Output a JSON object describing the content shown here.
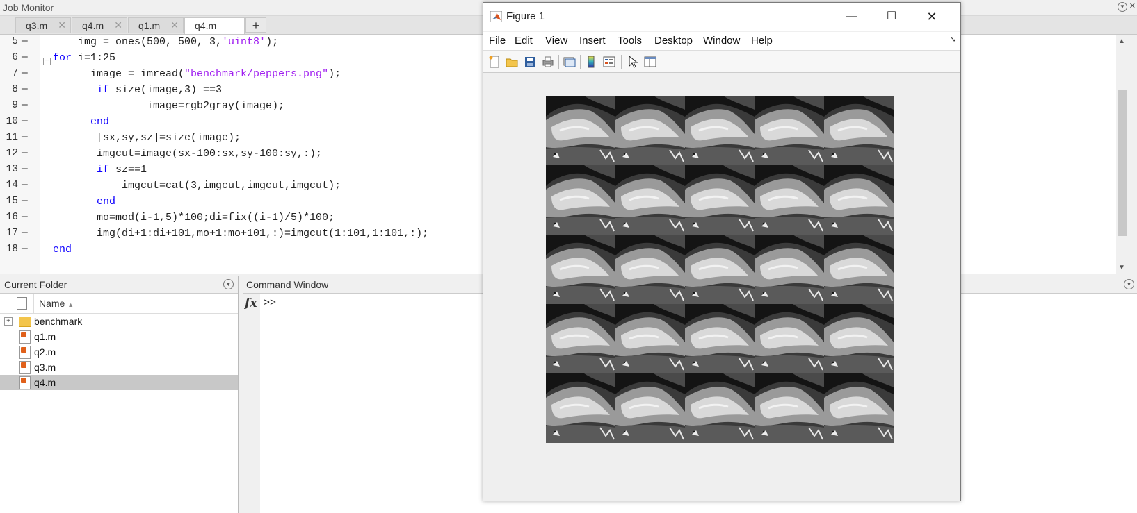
{
  "job_monitor": {
    "title": "Job Monitor"
  },
  "editor": {
    "tabs": [
      {
        "label": "q3.m",
        "active": false
      },
      {
        "label": "q4.m",
        "active": false
      },
      {
        "label": "q1.m",
        "active": false
      },
      {
        "label": "q4.m",
        "active": true
      }
    ],
    "new_tab_label": "+",
    "lines": [
      {
        "num": "5",
        "parts": [
          [
            "",
            "    img = ones(500, 500, 3,"
          ],
          [
            "str",
            "'uint8'"
          ],
          [
            "",
            ");"
          ]
        ]
      },
      {
        "num": "6",
        "parts": [
          [
            "kw",
            "for "
          ],
          [
            "",
            "i=1:25"
          ]
        ]
      },
      {
        "num": "7",
        "parts": [
          [
            "",
            "      image = imread("
          ],
          [
            "str",
            "\"benchmark/peppers.png\""
          ],
          [
            "",
            ");"
          ]
        ]
      },
      {
        "num": "8",
        "parts": [
          [
            "kw",
            "       if "
          ],
          [
            "",
            "size(image,3) ==3"
          ]
        ]
      },
      {
        "num": "9",
        "parts": [
          [
            "",
            "               image=rgb2gray(image);"
          ]
        ]
      },
      {
        "num": "10",
        "parts": [
          [
            "kw",
            "      end"
          ]
        ]
      },
      {
        "num": "11",
        "parts": [
          [
            "",
            "       [sx,sy,sz]=size(image);"
          ]
        ]
      },
      {
        "num": "12",
        "parts": [
          [
            "",
            "       imgcut=image(sx-100:sx,sy-100:sy,:);"
          ]
        ]
      },
      {
        "num": "13",
        "parts": [
          [
            "kw",
            "       if "
          ],
          [
            "",
            "sz==1"
          ]
        ]
      },
      {
        "num": "14",
        "parts": [
          [
            "",
            "           imgcut=cat(3,imgcut,imgcut,imgcut);"
          ]
        ]
      },
      {
        "num": "15",
        "parts": [
          [
            "kw",
            "       end"
          ]
        ]
      },
      {
        "num": "16",
        "parts": [
          [
            "",
            "       mo=mod(i-1,5)*100;di=fix((i-1)/5)*100;"
          ]
        ]
      },
      {
        "num": "17",
        "parts": [
          [
            "",
            "       img(di+1:di+101,mo+1:mo+101,:)=imgcut(1:101,1:101,:);"
          ]
        ]
      },
      {
        "num": "18",
        "parts": [
          [
            "kw",
            "end"
          ]
        ]
      }
    ]
  },
  "current_folder": {
    "title": "Current Folder",
    "column_name": "Name",
    "items": [
      {
        "label": "benchmark",
        "type": "folder",
        "selected": false
      },
      {
        "label": "q1.m",
        "type": "mfile",
        "selected": false
      },
      {
        "label": "q2.m",
        "type": "mfile",
        "selected": false
      },
      {
        "label": "q3.m",
        "type": "mfile",
        "selected": false
      },
      {
        "label": "q4.m",
        "type": "mfile",
        "selected": true
      }
    ]
  },
  "command_window": {
    "title": "Command Window",
    "fx": "fx",
    "prompt": ">>"
  },
  "figure": {
    "title": "Figure 1",
    "menu": [
      "File",
      "Edit",
      "View",
      "Insert",
      "Tools",
      "Desktop",
      "Window",
      "Help"
    ],
    "toolbar_icons": [
      "new-figure-icon",
      "open-file-icon",
      "save-icon",
      "print-icon",
      "link-plot-icon",
      "colorbar-icon",
      "legend-icon",
      "pointer-icon",
      "property-editor-icon"
    ],
    "image_grid": {
      "rows": 5,
      "cols": 5
    }
  }
}
